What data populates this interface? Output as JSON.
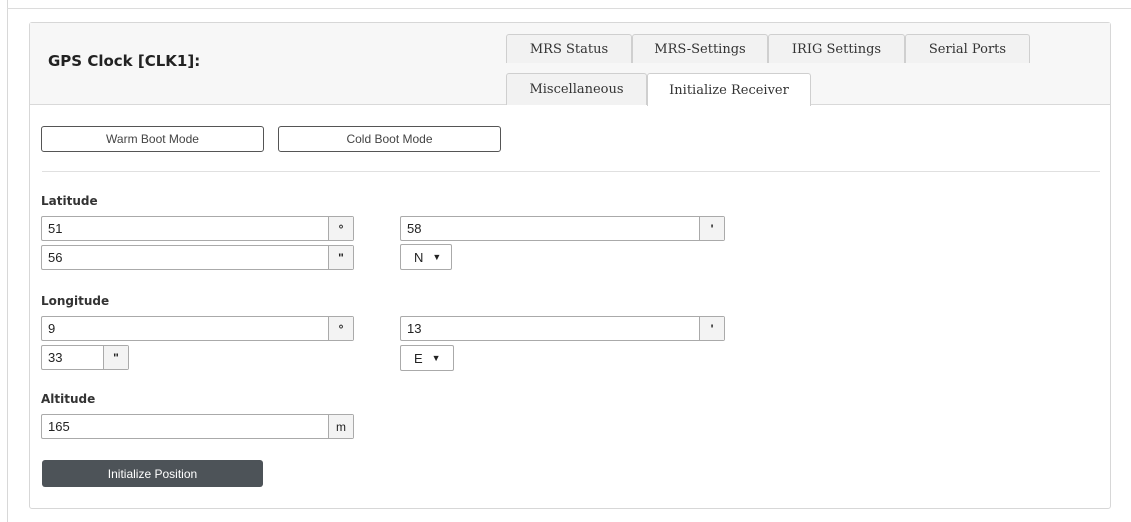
{
  "title": "GPS Clock [CLK1]:",
  "tabs": {
    "mrs_status": "MRS Status",
    "mrs_settings": "MRS-Settings",
    "irig_settings": "IRIG Settings",
    "serial_ports": "Serial Ports",
    "miscellaneous": "Miscellaneous",
    "initialize_receiver": "Initialize Receiver",
    "active": "Initialize Receiver"
  },
  "boot": {
    "warm": "Warm Boot Mode",
    "cold": "Cold Boot Mode"
  },
  "latitude": {
    "label": "Latitude",
    "degrees": "51",
    "degrees_unit": "°",
    "minutes": "58",
    "minutes_unit": "'",
    "seconds": "56",
    "seconds_unit": "\"",
    "hemisphere": "N"
  },
  "longitude": {
    "label": "Longitude",
    "degrees": "9",
    "degrees_unit": "°",
    "minutes": "13",
    "minutes_unit": "'",
    "seconds": "33",
    "seconds_unit": "\"",
    "hemisphere": "E"
  },
  "altitude": {
    "label": "Altitude",
    "value": "165",
    "unit": "m"
  },
  "actions": {
    "initialize_position": "Initialize Position"
  }
}
